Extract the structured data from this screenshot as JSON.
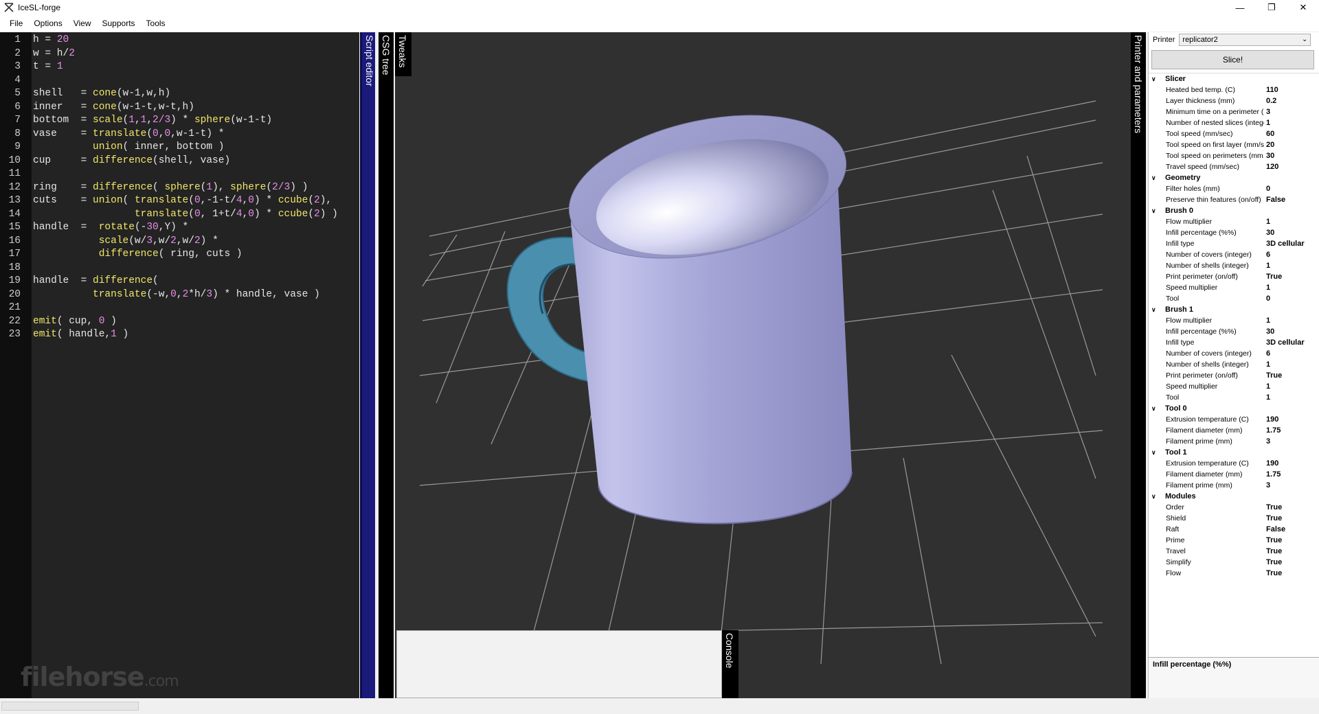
{
  "window": {
    "title": "IceSL-forge",
    "controls": [
      "minimize-icon",
      "restore-icon",
      "close-icon"
    ]
  },
  "menu": [
    "File",
    "Options",
    "View",
    "Supports",
    "Tools"
  ],
  "editor": {
    "lines": [
      [
        [
          "h",
          "v"
        ],
        [
          " = ",
          "o"
        ],
        [
          "20",
          "n"
        ]
      ],
      [
        [
          "w",
          "v"
        ],
        [
          " = h/",
          "o"
        ],
        [
          "2",
          "n"
        ]
      ],
      [
        [
          "t",
          "v"
        ],
        [
          " = ",
          "o"
        ],
        [
          "1",
          "n"
        ]
      ],
      [],
      [
        [
          "shell   = ",
          "v"
        ],
        [
          "cone",
          "f"
        ],
        [
          "(w-1,w,h)",
          "o"
        ]
      ],
      [
        [
          "inner   = ",
          "v"
        ],
        [
          "cone",
          "f"
        ],
        [
          "(w-1-t,w-t,h)",
          "o"
        ]
      ],
      [
        [
          "bottom  = ",
          "v"
        ],
        [
          "scale",
          "f"
        ],
        [
          "(",
          "o"
        ],
        [
          "1",
          "n"
        ],
        [
          ",",
          "o"
        ],
        [
          "1",
          "n"
        ],
        [
          ",",
          "o"
        ],
        [
          "2/3",
          "n"
        ],
        [
          ") * ",
          "o"
        ],
        [
          "sphere",
          "f"
        ],
        [
          "(w-1-t)",
          "o"
        ]
      ],
      [
        [
          "vase    = ",
          "v"
        ],
        [
          "translate",
          "f"
        ],
        [
          "(",
          "o"
        ],
        [
          "0",
          "n"
        ],
        [
          ",",
          "o"
        ],
        [
          "0",
          "n"
        ],
        [
          ",w-1-t) *",
          "o"
        ]
      ],
      [
        [
          "          ",
          "o"
        ],
        [
          "union",
          "f"
        ],
        [
          "( inner, bottom )",
          "o"
        ]
      ],
      [
        [
          "cup     = ",
          "v"
        ],
        [
          "difference",
          "f"
        ],
        [
          "(shell, vase)",
          "o"
        ]
      ],
      [],
      [
        [
          "ring    = ",
          "v"
        ],
        [
          "difference",
          "f"
        ],
        [
          "( ",
          "o"
        ],
        [
          "sphere",
          "f"
        ],
        [
          "(",
          "o"
        ],
        [
          "1",
          "n"
        ],
        [
          "), ",
          "o"
        ],
        [
          "sphere",
          "f"
        ],
        [
          "(",
          "o"
        ],
        [
          "2/3",
          "n"
        ],
        [
          ") )",
          "o"
        ]
      ],
      [
        [
          "cuts    = ",
          "v"
        ],
        [
          "union",
          "f"
        ],
        [
          "( ",
          "o"
        ],
        [
          "translate",
          "f"
        ],
        [
          "(",
          "o"
        ],
        [
          "0",
          "n"
        ],
        [
          ",-1-t/",
          "o"
        ],
        [
          "4",
          "n"
        ],
        [
          ",",
          "o"
        ],
        [
          "0",
          "n"
        ],
        [
          ") * ",
          "o"
        ],
        [
          "ccube",
          "f"
        ],
        [
          "(",
          "o"
        ],
        [
          "2",
          "n"
        ],
        [
          "),",
          "o"
        ]
      ],
      [
        [
          "                 ",
          "o"
        ],
        [
          "translate",
          "f"
        ],
        [
          "(",
          "o"
        ],
        [
          "0",
          "n"
        ],
        [
          ", 1+t/",
          "o"
        ],
        [
          "4",
          "n"
        ],
        [
          ",",
          "o"
        ],
        [
          "0",
          "n"
        ],
        [
          ") * ",
          "o"
        ],
        [
          "ccube",
          "f"
        ],
        [
          "(",
          "o"
        ],
        [
          "2",
          "n"
        ],
        [
          ") )",
          "o"
        ]
      ],
      [
        [
          "handle  =  ",
          "v"
        ],
        [
          "rotate",
          "f"
        ],
        [
          "(-",
          "o"
        ],
        [
          "30",
          "n"
        ],
        [
          ",Y) *",
          "o"
        ]
      ],
      [
        [
          "           ",
          "o"
        ],
        [
          "scale",
          "f"
        ],
        [
          "(w/",
          "o"
        ],
        [
          "3",
          "n"
        ],
        [
          ",w/",
          "o"
        ],
        [
          "2",
          "n"
        ],
        [
          ",w/",
          "o"
        ],
        [
          "2",
          "n"
        ],
        [
          ") *",
          "o"
        ]
      ],
      [
        [
          "           ",
          "o"
        ],
        [
          "difference",
          "f"
        ],
        [
          "( ring, cuts )",
          "o"
        ]
      ],
      [],
      [
        [
          "handle  = ",
          "v"
        ],
        [
          "difference",
          "f"
        ],
        [
          "(",
          "o"
        ]
      ],
      [
        [
          "          ",
          "o"
        ],
        [
          "translate",
          "f"
        ],
        [
          "(-w,",
          "o"
        ],
        [
          "0",
          "n"
        ],
        [
          ",",
          "o"
        ],
        [
          "2",
          "n"
        ],
        [
          "*h/",
          "o"
        ],
        [
          "3",
          "n"
        ],
        [
          ") * handle, vase )",
          "o"
        ]
      ],
      [],
      [
        [
          "emit",
          "f"
        ],
        [
          "( cup, ",
          "o"
        ],
        [
          "0",
          "n"
        ],
        [
          " )",
          "o"
        ]
      ],
      [
        [
          "emit",
          "f"
        ],
        [
          "( handle,",
          "o"
        ],
        [
          "1",
          "n"
        ],
        [
          " )",
          "o"
        ]
      ]
    ]
  },
  "watermark": {
    "main": "filehorse",
    "suffix": ".com"
  },
  "tabs": {
    "script_editor": "Script editor",
    "csg_tree": "CSG tree",
    "tweaks": "Tweaks",
    "console": "Console",
    "printer_params": "Printer and parameters"
  },
  "printer": {
    "label": "Printer",
    "selected": "replicator2",
    "slice_label": "Slice!"
  },
  "params": [
    {
      "section": "Slicer",
      "rows": [
        [
          "Heated bed temp. (C)",
          "110"
        ],
        [
          "Layer thickness (mm)",
          "0.2"
        ],
        [
          "Minimum time on a perimeter (s",
          "3"
        ],
        [
          "Number of nested slices (intege",
          "1"
        ],
        [
          "Tool speed (mm/sec)",
          "60"
        ],
        [
          "Tool speed on first layer (mm/s",
          "20"
        ],
        [
          "Tool speed on perimeters (mm.",
          "30"
        ],
        [
          "Travel speed (mm/sec)",
          "120"
        ]
      ]
    },
    {
      "section": "Geometry",
      "rows": [
        [
          "Filter holes (mm)",
          "0"
        ],
        [
          "Preserve thin features (on/off)",
          "False"
        ]
      ]
    },
    {
      "section": "Brush 0",
      "rows": [
        [
          "Flow multiplier",
          "1"
        ],
        [
          "Infill percentage (%%)",
          "30"
        ],
        [
          "Infill type",
          "3D cellular"
        ],
        [
          "Number of covers (integer)",
          "6"
        ],
        [
          "Number of shells (integer)",
          "1"
        ],
        [
          "Print perimeter (on/off)",
          "True"
        ],
        [
          "Speed multiplier",
          "1"
        ],
        [
          "Tool",
          "0"
        ]
      ]
    },
    {
      "section": "Brush 1",
      "rows": [
        [
          "Flow multiplier",
          "1"
        ],
        [
          "Infill percentage (%%)",
          "30"
        ],
        [
          "Infill type",
          "3D cellular"
        ],
        [
          "Number of covers (integer)",
          "6"
        ],
        [
          "Number of shells (integer)",
          "1"
        ],
        [
          "Print perimeter (on/off)",
          "True"
        ],
        [
          "Speed multiplier",
          "1"
        ],
        [
          "Tool",
          "1"
        ]
      ]
    },
    {
      "section": "Tool 0",
      "rows": [
        [
          "Extrusion temperature (C)",
          "190"
        ],
        [
          "Filament diameter (mm)",
          "1.75"
        ],
        [
          "Filament prime (mm)",
          "3"
        ]
      ]
    },
    {
      "section": "Tool 1",
      "rows": [
        [
          "Extrusion temperature (C)",
          "190"
        ],
        [
          "Filament diameter (mm)",
          "1.75"
        ],
        [
          "Filament prime (mm)",
          "3"
        ]
      ]
    },
    {
      "section": "Modules",
      "rows": [
        [
          "Order",
          "True"
        ],
        [
          "Shield",
          "True"
        ],
        [
          "Raft",
          "False"
        ],
        [
          "Prime",
          "True"
        ],
        [
          "Travel",
          "True"
        ],
        [
          "Simplify",
          "True"
        ],
        [
          "Flow",
          "True"
        ]
      ]
    }
  ],
  "description": "Infill percentage (%%)",
  "colors": {
    "cup": "#a4a4d8",
    "handle": "#4a8fae",
    "viewport_bg": "#303030",
    "grid": "#9a9a9a"
  }
}
